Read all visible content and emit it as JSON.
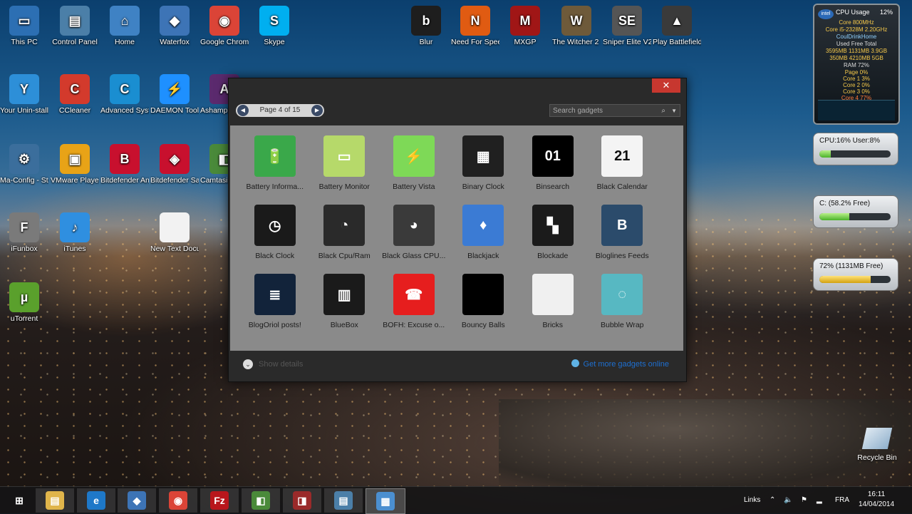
{
  "desktop": {
    "icons": [
      {
        "label": "This PC",
        "color": "#2c6fb3",
        "glyph": "▭"
      },
      {
        "label": "Control Panel",
        "color": "#4b7fa8",
        "glyph": "▤"
      },
      {
        "label": "Home",
        "color": "#3f82c4",
        "glyph": "⌂"
      },
      {
        "label": "Waterfox",
        "color": "#3d74b6",
        "glyph": "◆"
      },
      {
        "label": "Google Chrome",
        "color": "#db4437",
        "glyph": "◉"
      },
      {
        "label": "Skype",
        "color": "#00aff0",
        "glyph": "S"
      },
      {
        "label": "Your Unin-staller!",
        "color": "#2d8fd8",
        "glyph": "Y"
      },
      {
        "label": "CCleaner",
        "color": "#d33a2c",
        "glyph": "C"
      },
      {
        "label": "Advanced SystemCare 7",
        "color": "#1a8ed1",
        "glyph": "C"
      },
      {
        "label": "DAEMON Tools Lite",
        "color": "#1e90ff",
        "glyph": "⚡"
      },
      {
        "label": "Ashampoo Burning",
        "color": "#5b2a6e",
        "glyph": "A"
      },
      {
        "label": "Ma-Config - Start the ...",
        "color": "#3b6e9c",
        "glyph": "⚙"
      },
      {
        "label": "VMware Player",
        "color": "#e8a317",
        "glyph": "▣"
      },
      {
        "label": "Bitdefender Antivirus ...",
        "color": "#c8102e",
        "glyph": "B"
      },
      {
        "label": "Bitdefender Safepay",
        "color": "#c8102e",
        "glyph": "◈"
      },
      {
        "label": "Camtasia Studio",
        "color": "#4a8a3a",
        "glyph": "◧"
      },
      {
        "label": "iFunbox",
        "color": "#7a7a7a",
        "glyph": "F"
      },
      {
        "label": "iTunes",
        "color": "#2f8fe0",
        "glyph": "♪"
      },
      {
        "label": "New Text Document...",
        "color": "#f2f2f2",
        "glyph": ""
      },
      {
        "label": "uTorrent",
        "color": "#5aa02c",
        "glyph": "µ"
      },
      {
        "label": "Blur",
        "color": "#1e1e1e",
        "glyph": "b"
      },
      {
        "label": "Need For Speed T...",
        "color": "#e05b12",
        "glyph": "N"
      },
      {
        "label": "MXGP",
        "color": "#a01616",
        "glyph": "M"
      },
      {
        "label": "The Witcher 2 - Assassi...",
        "color": "#6e5a3a",
        "glyph": "W"
      },
      {
        "label": "Sniper Elite V2",
        "color": "#555555",
        "glyph": "SE"
      },
      {
        "label": "Play Battlefield...",
        "color": "#3a3a3a",
        "glyph": "▲"
      }
    ]
  },
  "gallery": {
    "close_glyph": "✕",
    "pager_label": "Page 4 of 15",
    "pager_prev": "◀",
    "pager_next": "▶",
    "search_placeholder": "Search gadgets",
    "search_icon": "⌕",
    "search_dropdown": "▼",
    "gadgets": [
      {
        "name": "Battery Informa...",
        "color": "#3aa84a",
        "glyph": "🔋"
      },
      {
        "name": "Battery Monitor",
        "color": "#b6d96a",
        "glyph": "▭"
      },
      {
        "name": "Battery Vista",
        "color": "#7ed957",
        "glyph": "⚡"
      },
      {
        "name": "Binary Clock",
        "color": "#202020",
        "glyph": "▦"
      },
      {
        "name": "Binsearch",
        "color": "#000000",
        "glyph": "01"
      },
      {
        "name": "Black Calendar",
        "color": "#f4f4f4",
        "glyph": "21"
      },
      {
        "name": "Black Clock",
        "color": "#1a1a1a",
        "glyph": "◷"
      },
      {
        "name": "Black Cpu/Ram",
        "color": "#2a2a2a",
        "glyph": "◔"
      },
      {
        "name": "Black Glass CPU...",
        "color": "#3a3a3a",
        "glyph": "◕"
      },
      {
        "name": "Blackjack",
        "color": "#3b7bd4",
        "glyph": "♦"
      },
      {
        "name": "Blockade",
        "color": "#1b1b1b",
        "glyph": "▚"
      },
      {
        "name": "Bloglines Feeds",
        "color": "#2b4b6b",
        "glyph": "B"
      },
      {
        "name": "BlogOriol posts!",
        "color": "#12233a",
        "glyph": "≣"
      },
      {
        "name": "BlueBox",
        "color": "#1a1a1a",
        "glyph": "▥"
      },
      {
        "name": "BOFH: Excuse o...",
        "color": "#e61e1e",
        "glyph": "☎"
      },
      {
        "name": "Bouncy Balls",
        "color": "#000000",
        "glyph": ""
      },
      {
        "name": "Bricks",
        "color": "#f0f0f0",
        "glyph": ""
      },
      {
        "name": "Bubble Wrap",
        "color": "#57b8c2",
        "glyph": "◌"
      }
    ],
    "details_chevron": "⌄",
    "details_label": "Show details",
    "online_label": "Get more gadgets online"
  },
  "cpu_gadget": {
    "badge": "intel",
    "title": "CPU Usage",
    "percent": "12%",
    "clock_line": "Core 800MHz",
    "cpu_line": "Core i5-2328M 2.20GHz",
    "host_line": "CoulDrinkHome",
    "table_header": "Used   Free   Total",
    "row1": "3595MB   1131MB   3.9GB",
    "row2": "350MB   4210MB   5GB",
    "row3": "RAM   72%",
    "cores": [
      "Page   0%",
      "Core 1   3%",
      "Core 2   0%",
      "Core 3   0%",
      "Core 4   77%"
    ]
  },
  "meters": [
    {
      "label": "CPU:16%   User:8%",
      "fill": 0.16
    },
    {
      "label": "C: (58.2% Free)",
      "fill": 0.42
    },
    {
      "label": "72% (1131MB Free)",
      "fill": 0.72
    }
  ],
  "recycle_bin": {
    "label": "Recycle Bin"
  },
  "taskbar": {
    "items": [
      {
        "name": "start",
        "glyph": "⊞",
        "color": "transparent"
      },
      {
        "name": "file-explorer",
        "glyph": "▤",
        "color": "#e0b54b"
      },
      {
        "name": "internet-explorer",
        "glyph": "e",
        "color": "#1e78c8"
      },
      {
        "name": "waterfox",
        "glyph": "◆",
        "color": "#3d74b6"
      },
      {
        "name": "chrome",
        "glyph": "◉",
        "color": "#db4437"
      },
      {
        "name": "filezilla",
        "glyph": "Fz",
        "color": "#b8161c"
      },
      {
        "name": "camtasia",
        "glyph": "◧",
        "color": "#4a8a3a"
      },
      {
        "name": "camtasia-recorder",
        "glyph": "◨",
        "color": "#9a2a2a"
      },
      {
        "name": "control-panel",
        "glyph": "▤",
        "color": "#4b7fa8"
      },
      {
        "name": "gadgets",
        "glyph": "▦",
        "color": "#4b8fd0"
      }
    ],
    "links": "Links",
    "language": "FRA",
    "time": "16:11",
    "date": "14/04/2014"
  }
}
